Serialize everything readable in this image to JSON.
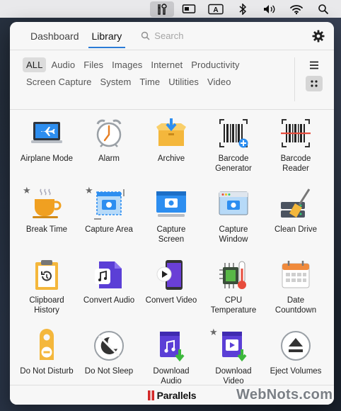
{
  "menubar": {
    "items": [
      {
        "name": "parallels-toolbox-icon",
        "active": true
      },
      {
        "name": "screen-mirror-icon"
      },
      {
        "name": "keyboard-input-icon",
        "text": "A"
      },
      {
        "name": "bluetooth-icon"
      },
      {
        "name": "volume-icon"
      },
      {
        "name": "wifi-icon"
      },
      {
        "name": "spotlight-search-icon"
      }
    ]
  },
  "header": {
    "tabs": [
      {
        "label": "Dashboard",
        "active": false
      },
      {
        "label": "Library",
        "active": true
      }
    ],
    "search_placeholder": "Search",
    "settings_icon": "gear-icon"
  },
  "filters": {
    "row1": [
      "ALL",
      "Audio",
      "Files",
      "Images",
      "Internet",
      "Productivity"
    ],
    "row2": [
      "Screen Capture",
      "System",
      "Time",
      "Utilities",
      "Video"
    ],
    "active": "ALL"
  },
  "tools": [
    {
      "label": "Airplane Mode",
      "icon": "airplane-mode-icon",
      "starred": false
    },
    {
      "label": "Alarm",
      "icon": "alarm-clock-icon",
      "starred": false
    },
    {
      "label": "Archive",
      "icon": "archive-box-icon",
      "starred": false
    },
    {
      "label": "Barcode\nGenerator",
      "icon": "barcode-generator-icon",
      "starred": false
    },
    {
      "label": "Barcode\nReader",
      "icon": "barcode-reader-icon",
      "starred": false
    },
    {
      "label": "Break Time",
      "icon": "coffee-cup-icon",
      "starred": true
    },
    {
      "label": "Capture Area",
      "icon": "capture-area-icon",
      "starred": true
    },
    {
      "label": "Capture\nScreen",
      "icon": "capture-screen-icon",
      "starred": false
    },
    {
      "label": "Capture\nWindow",
      "icon": "capture-window-icon",
      "starred": false
    },
    {
      "label": "Clean Drive",
      "icon": "clean-drive-icon",
      "starred": false
    },
    {
      "label": "Clipboard\nHistory",
      "icon": "clipboard-history-icon",
      "starred": false
    },
    {
      "label": "Convert Audio",
      "icon": "convert-audio-icon",
      "starred": false
    },
    {
      "label": "Convert Video",
      "icon": "convert-video-icon",
      "starred": false
    },
    {
      "label": "CPU\nTemperature",
      "icon": "cpu-temperature-icon",
      "starred": false
    },
    {
      "label": "Date\nCountdown",
      "icon": "calendar-countdown-icon",
      "starred": false
    },
    {
      "label": "Do Not Disturb",
      "icon": "do-not-disturb-icon",
      "starred": false
    },
    {
      "label": "Do Not Sleep",
      "icon": "do-not-sleep-icon",
      "starred": false
    },
    {
      "label": "Download\nAudio",
      "icon": "download-audio-icon",
      "starred": false
    },
    {
      "label": "Download\nVideo",
      "icon": "download-video-icon",
      "starred": true
    },
    {
      "label": "Eject Volumes",
      "icon": "eject-icon",
      "starred": false
    }
  ],
  "star_glyph": "★",
  "footer": {
    "brand": "Parallels"
  },
  "watermark": "WebNots.com",
  "colors": {
    "accent": "#2b7bd6",
    "panel_bg": "#f7f7f7",
    "brand_red": "#d42a2a"
  }
}
